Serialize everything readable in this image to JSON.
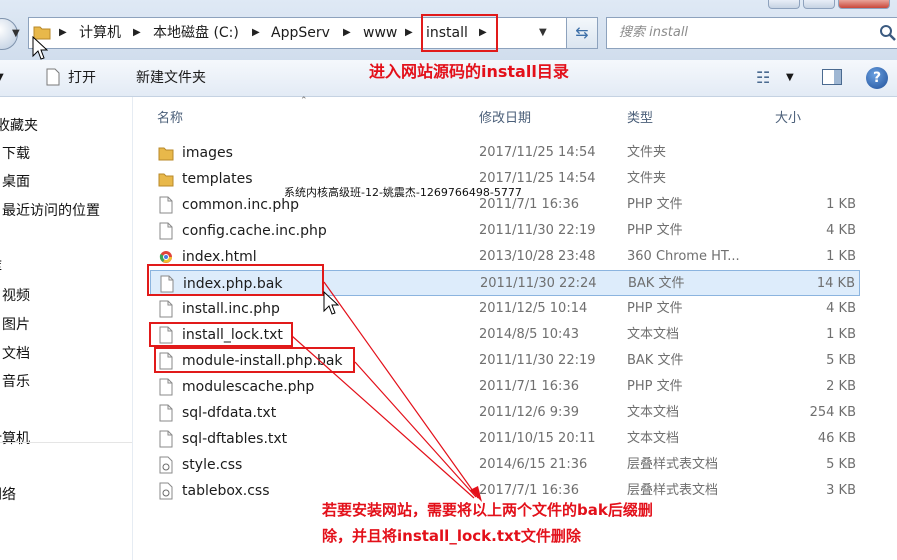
{
  "address_bar": {
    "crumbs": [
      "计算机",
      "本地磁盘 (C:)",
      "AppServ",
      "www",
      "install"
    ],
    "search_placeholder": "搜索 install"
  },
  "toolbar": {
    "open_label": "打开",
    "new_folder_label": "新建文件夹"
  },
  "sidebar": {
    "items": [
      "收藏夹",
      "下载",
      "桌面",
      "最近访问的位置",
      "库",
      "视频",
      "图片",
      "文档",
      "音乐",
      "计算机",
      "网络"
    ]
  },
  "columns": {
    "name": "名称",
    "date": "修改日期",
    "type": "类型",
    "size": "大小"
  },
  "files": [
    {
      "name": "images",
      "date": "2017/11/25 14:54",
      "type": "文件夹",
      "size": "",
      "icon": "folder-icon"
    },
    {
      "name": "templates",
      "date": "2017/11/25 14:54",
      "type": "文件夹",
      "size": "",
      "icon": "folder-icon"
    },
    {
      "name": "common.inc.php",
      "date": "2011/7/1 16:36",
      "type": "PHP 文件",
      "size": "1 KB",
      "icon": "file-icon"
    },
    {
      "name": "config.cache.inc.php",
      "date": "2011/11/30 22:19",
      "type": "PHP 文件",
      "size": "4 KB",
      "icon": "file-icon"
    },
    {
      "name": "index.html",
      "date": "2013/10/28 23:48",
      "type": "360 Chrome HT...",
      "size": "1 KB",
      "icon": "chrome-icon"
    },
    {
      "name": "index.php.bak",
      "date": "2011/11/30 22:24",
      "type": "BAK 文件",
      "size": "14 KB",
      "icon": "file-icon",
      "selected": true
    },
    {
      "name": "install.inc.php",
      "date": "2011/12/5 10:14",
      "type": "PHP 文件",
      "size": "4 KB",
      "icon": "file-icon"
    },
    {
      "name": "install_lock.txt",
      "date": "2014/8/5 10:43",
      "type": "文本文档",
      "size": "1 KB",
      "icon": "file-icon"
    },
    {
      "name": "module-install.php.bak",
      "date": "2011/11/30 22:19",
      "type": "BAK 文件",
      "size": "5 KB",
      "icon": "file-icon"
    },
    {
      "name": "modulescache.php",
      "date": "2011/7/1 16:36",
      "type": "PHP 文件",
      "size": "2 KB",
      "icon": "file-icon"
    },
    {
      "name": "sql-dfdata.txt",
      "date": "2011/12/6 9:39",
      "type": "文本文档",
      "size": "254 KB",
      "icon": "file-icon"
    },
    {
      "name": "sql-dftables.txt",
      "date": "2011/10/15 20:11",
      "type": "文本文档",
      "size": "46 KB",
      "icon": "file-icon"
    },
    {
      "name": "style.css",
      "date": "2014/6/15 21:36",
      "type": "层叠样式表文档",
      "size": "5 KB",
      "icon": "css-icon"
    },
    {
      "name": "tablebox.css",
      "date": "2017/7/1 16:36",
      "type": "层叠样式表文档",
      "size": "3 KB",
      "icon": "css-icon"
    }
  ],
  "annotations": {
    "top": "进入网站源码的install目录",
    "bottom_line1": "若要安装网站，需要将以上两个文件的bak后缀删",
    "bottom_line2": "除，并且将install_lock.txt文件删除",
    "watermark": "系统内核高级班-12-姚震杰-1269766498-5777"
  },
  "colors": {
    "annotation": "#e3101a",
    "selection": "#ddecfb",
    "folder": "#e8b84a"
  }
}
